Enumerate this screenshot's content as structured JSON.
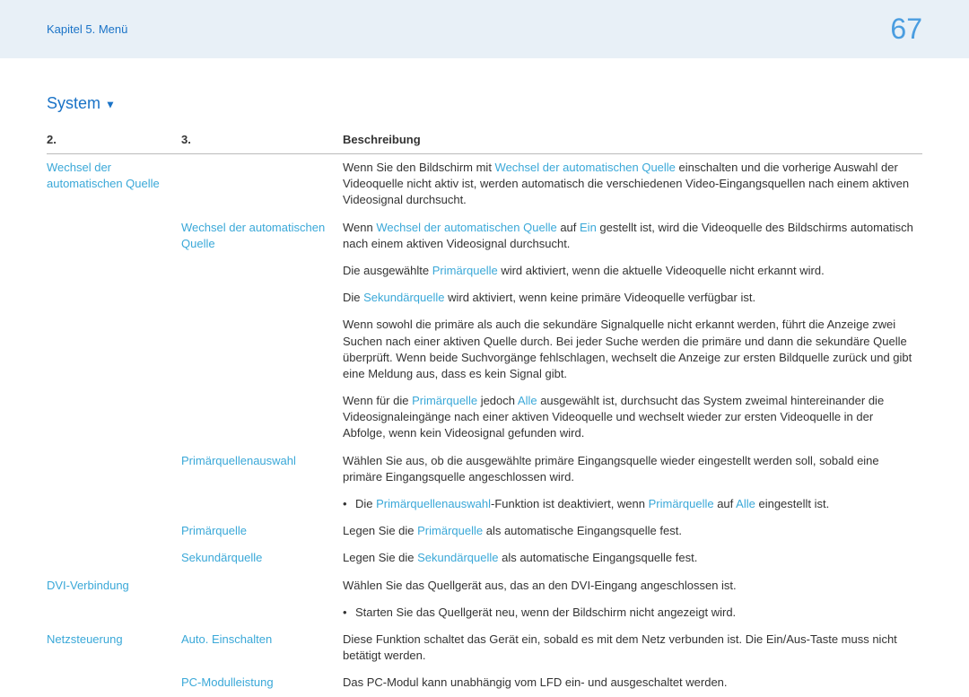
{
  "header": {
    "breadcrumb": "Kapitel 5. Menü",
    "page_number": "67"
  },
  "section": {
    "title": "System",
    "arrow": "▼"
  },
  "table": {
    "headers": {
      "col2": "2.",
      "col3": "3.",
      "desc": "Beschreibung"
    },
    "rows": [
      {
        "c2": "Wechsel der automatischen Quelle",
        "c3": "",
        "desc_parts": [
          {
            "t": "Wenn Sie den Bildschirm mit "
          },
          {
            "t": "Wechsel der automatischen Quelle",
            "link": true
          },
          {
            "t": " einschalten und die vorherige Auswahl der Videoquelle nicht aktiv ist, werden automatisch die verschiedenen Video-Eingangsquellen nach einem aktiven Videosignal durchsucht."
          }
        ]
      },
      {
        "c2": "",
        "c3": "Wechsel der automatischen Quelle",
        "desc_parts": [
          {
            "t": "Wenn "
          },
          {
            "t": "Wechsel der automatischen Quelle",
            "link": true
          },
          {
            "t": " auf "
          },
          {
            "t": "Ein",
            "link": true
          },
          {
            "t": " gestellt ist, wird die Videoquelle des Bildschirms automatisch nach einem aktiven Videosignal durchsucht."
          }
        ]
      },
      {
        "c2": "",
        "c3": "",
        "desc_parts": [
          {
            "t": "Die ausgewählte "
          },
          {
            "t": "Primärquelle",
            "link": true
          },
          {
            "t": " wird aktiviert, wenn die aktuelle Videoquelle nicht erkannt wird."
          }
        ]
      },
      {
        "c2": "",
        "c3": "",
        "desc_parts": [
          {
            "t": "Die "
          },
          {
            "t": "Sekundärquelle",
            "link": true
          },
          {
            "t": " wird aktiviert, wenn keine primäre Videoquelle verfügbar ist."
          }
        ]
      },
      {
        "c2": "",
        "c3": "",
        "desc_parts": [
          {
            "t": "Wenn sowohl die primäre als auch die sekundäre Signalquelle nicht erkannt werden, führt die Anzeige zwei Suchen nach einer aktiven Quelle durch. Bei jeder Suche werden die primäre und dann die sekundäre Quelle überprüft. Wenn beide Suchvorgänge fehlschlagen, wechselt die Anzeige zur ersten Bildquelle zurück und gibt eine Meldung aus, dass es kein Signal gibt."
          }
        ]
      },
      {
        "c2": "",
        "c3": "",
        "desc_parts": [
          {
            "t": "Wenn für die "
          },
          {
            "t": "Primärquelle",
            "link": true
          },
          {
            "t": " jedoch "
          },
          {
            "t": "Alle",
            "link": true
          },
          {
            "t": " ausgewählt ist, durchsucht das System zweimal hintereinander die Videosignaleingänge nach einer aktiven Videoquelle und wechselt wieder zur ersten Videoquelle in der Abfolge, wenn kein Videosignal gefunden wird."
          }
        ]
      },
      {
        "c2": "",
        "c3": "Primärquellenauswahl",
        "desc_parts": [
          {
            "t": "Wählen Sie aus, ob die ausgewählte primäre Eingangsquelle wieder eingestellt werden soll, sobald eine primäre Eingangsquelle angeschlossen wird."
          }
        ]
      },
      {
        "c2": "",
        "c3": "",
        "bullet": true,
        "desc_parts": [
          {
            "t": "Die "
          },
          {
            "t": "Primärquellenauswahl",
            "link": true
          },
          {
            "t": "-Funktion ist deaktiviert, wenn "
          },
          {
            "t": "Primärquelle",
            "link": true
          },
          {
            "t": " auf "
          },
          {
            "t": "Alle",
            "link": true
          },
          {
            "t": " eingestellt ist."
          }
        ]
      },
      {
        "c2": "",
        "c3": "Primärquelle",
        "desc_parts": [
          {
            "t": "Legen Sie die "
          },
          {
            "t": "Primärquelle",
            "link": true
          },
          {
            "t": " als automatische Eingangsquelle fest."
          }
        ]
      },
      {
        "c2": "",
        "c3": "Sekundärquelle",
        "desc_parts": [
          {
            "t": "Legen Sie die "
          },
          {
            "t": "Sekundärquelle",
            "link": true
          },
          {
            "t": " als automatische Eingangsquelle fest."
          }
        ]
      },
      {
        "c2": "DVI-Verbindung",
        "c3": "",
        "desc_parts": [
          {
            "t": "Wählen Sie das Quellgerät aus, das an den DVI-Eingang angeschlossen ist."
          }
        ]
      },
      {
        "c2": "",
        "c3": "",
        "bullet": true,
        "desc_parts": [
          {
            "t": "Starten Sie das Quellgerät neu, wenn der Bildschirm nicht angezeigt wird."
          }
        ]
      },
      {
        "c2": "Netzsteuerung",
        "c3": "Auto. Einschalten",
        "desc_parts": [
          {
            "t": "Diese Funktion schaltet das Gerät ein, sobald es mit dem Netz verbunden ist. Die Ein/Aus-Taste muss nicht betätigt werden."
          }
        ]
      },
      {
        "c2": "",
        "c3": "PC-Modulleistung",
        "desc_parts": [
          {
            "t": "Das PC-Modul kann unabhängig vom LFD ein- und ausgeschaltet werden."
          }
        ]
      }
    ]
  }
}
